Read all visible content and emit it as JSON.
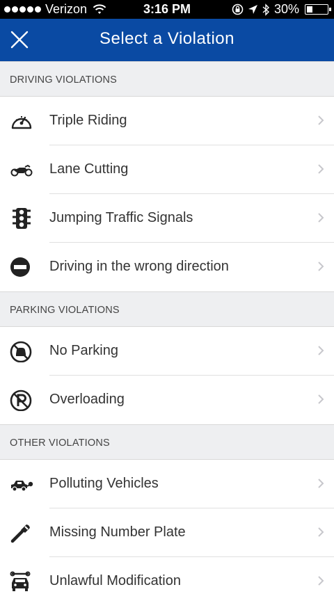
{
  "status": {
    "carrier": "Verizon",
    "time": "3:16 PM",
    "battery": "30%",
    "battery_level": 0.3
  },
  "nav": {
    "title": "Select a Violation",
    "close_icon": "close-icon"
  },
  "sections": [
    {
      "header": "DRIVING VIOLATIONS",
      "items": [
        {
          "label": "Triple Riding",
          "icon": "speedometer-icon"
        },
        {
          "label": "Lane Cutting",
          "icon": "motorcycle-icon"
        },
        {
          "label": "Jumping Traffic Signals",
          "icon": "traffic-light-icon"
        },
        {
          "label": "Driving in the wrong direction",
          "icon": "no-entry-icon"
        }
      ]
    },
    {
      "header": "PARKING VIOLATIONS",
      "items": [
        {
          "label": "No Parking",
          "icon": "no-car-icon"
        },
        {
          "label": "Overloading",
          "icon": "no-parking-icon"
        }
      ]
    },
    {
      "header": "OTHER VIOLATIONS",
      "items": [
        {
          "label": "Polluting Vehicles",
          "icon": "exhaust-car-icon"
        },
        {
          "label": "Missing Number Plate",
          "icon": "wrench-icon"
        },
        {
          "label": "Unlawful Modification",
          "icon": "car-wrench-icon"
        }
      ]
    }
  ],
  "colors": {
    "nav_bg": "#0a4aa3",
    "section_bg": "#eeeff1",
    "text": "#333333",
    "chevron": "#c7c7cc"
  }
}
